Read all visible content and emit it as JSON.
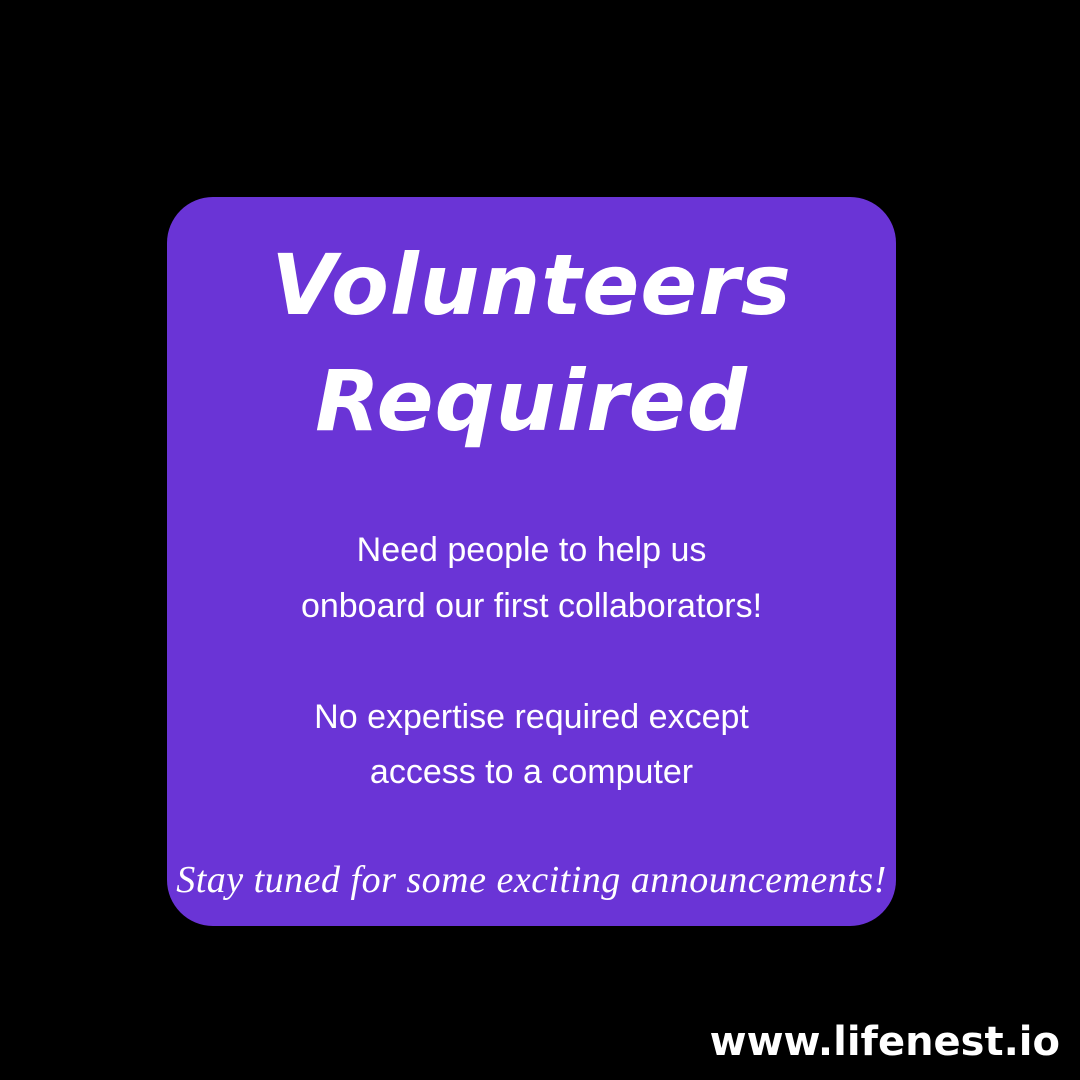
{
  "colors": {
    "background": "#000000",
    "card": "#6a34d6",
    "text": "#ffffff"
  },
  "card": {
    "headline_line1": "Volunteers",
    "headline_line2": "Required",
    "paragraph1_line1": "Need people to help us",
    "paragraph1_line2": "onboard our first collaborators!",
    "paragraph2_line1": "No expertise required except",
    "paragraph2_line2": "access to a computer",
    "tagline": "Stay tuned for some exciting announcements!"
  },
  "footer": {
    "website": "www.lifenest.io"
  }
}
